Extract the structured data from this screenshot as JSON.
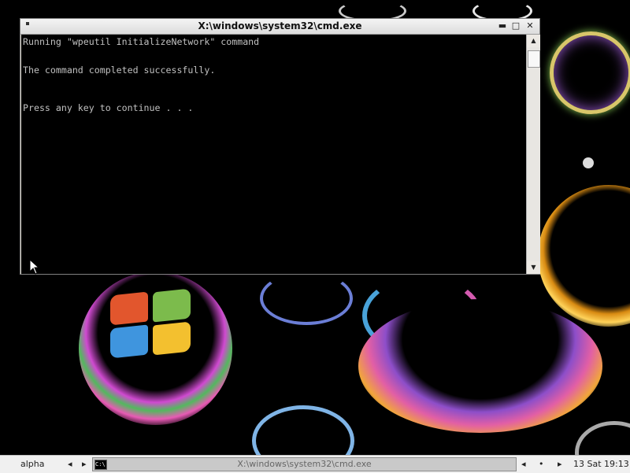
{
  "window": {
    "title": "X:\\windows\\system32\\cmd.exe",
    "minimize": "▬",
    "maximize": "□",
    "close": "✕"
  },
  "console": {
    "lines": [
      "Running \"wpeutil InitializeNetwork\" command",
      "The command completed successfully.",
      "Press any key to continue . . ."
    ]
  },
  "scrollbar": {
    "up": "▲",
    "down": "▼"
  },
  "taskbar": {
    "user": "alpha",
    "nav_left": "◂",
    "nav_right": "▸",
    "task_label": "X:\\windows\\system32\\cmd.exe",
    "task_icon": "C:\\",
    "tray_left": "◂",
    "tray_right": "▸",
    "clock": "13 Sat 19:13"
  }
}
